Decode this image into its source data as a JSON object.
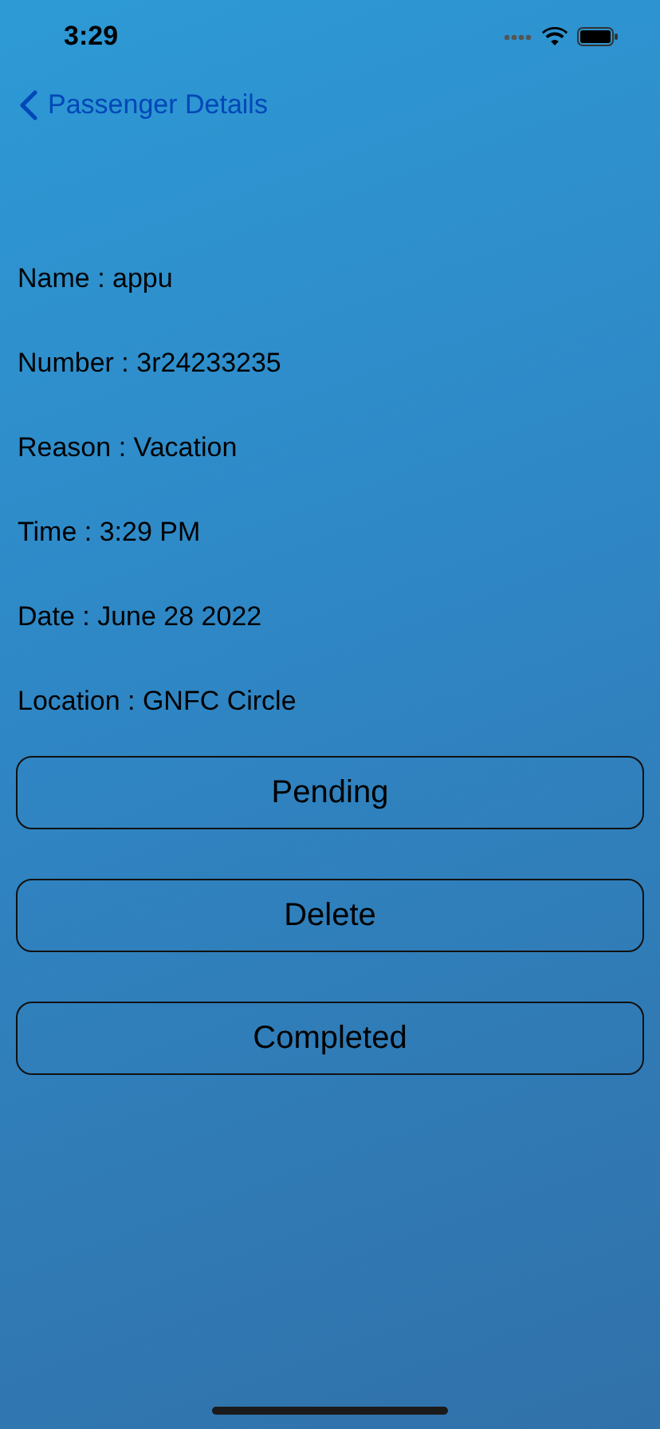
{
  "status_bar": {
    "time": "3:29"
  },
  "nav": {
    "back_label": "Passenger Details"
  },
  "details": [
    "Name : appu",
    "Number : 3r24233235",
    "Reason : Vacation",
    "Time : 3:29 PM",
    "Date : June 28 2022",
    "Location : GNFC Circle"
  ],
  "buttons": [
    "Pending",
    "Delete",
    "Completed"
  ]
}
